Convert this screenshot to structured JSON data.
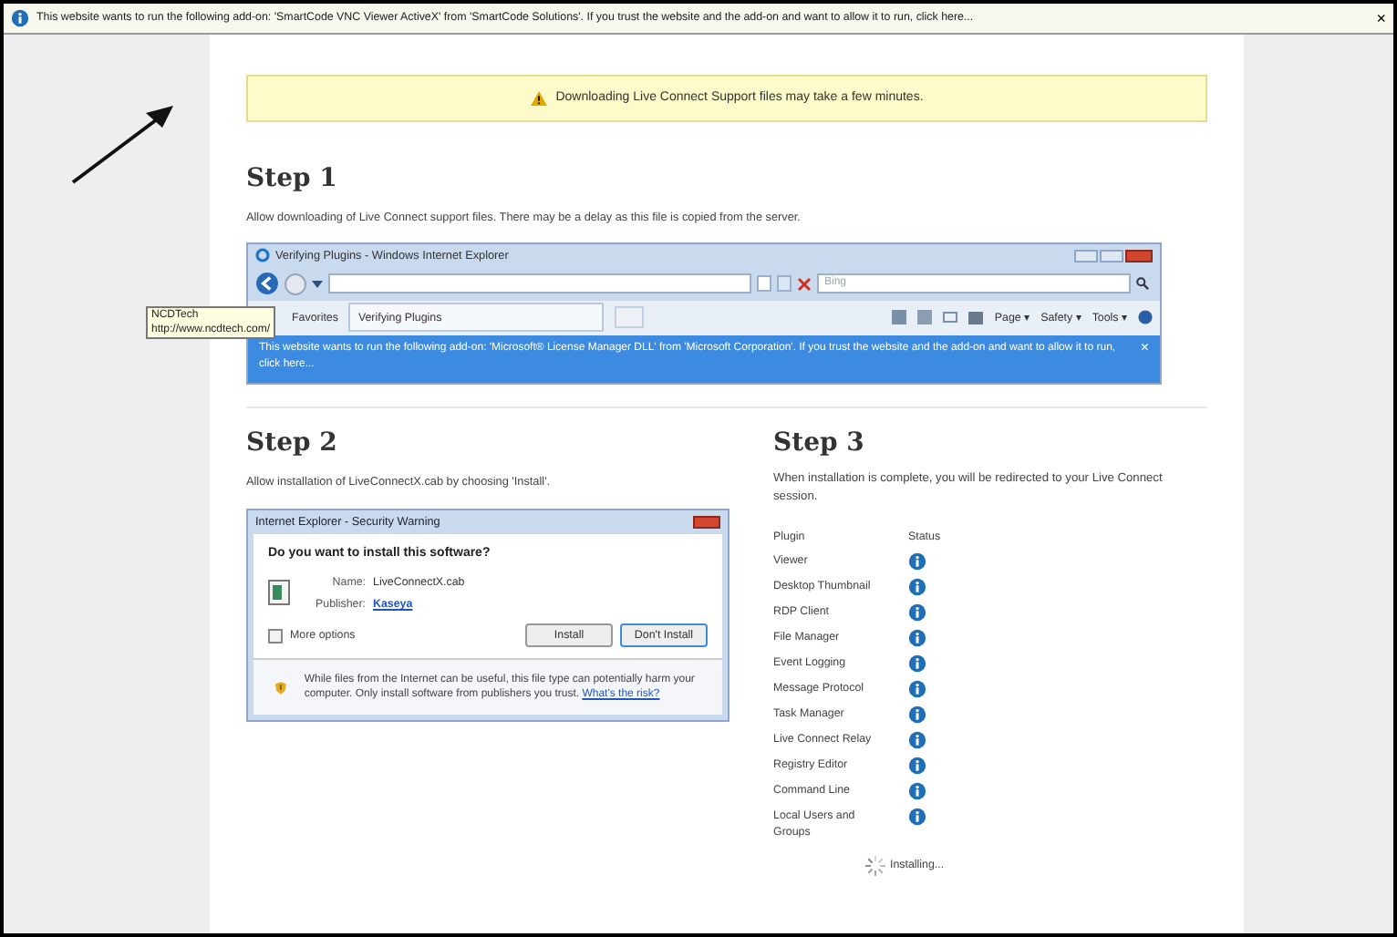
{
  "info_bar": {
    "text": "This website wants to run the following add-on: 'SmartCode VNC Viewer ActiveX' from 'SmartCode Solutions'. If you trust the website and the add-on and want to allow it to run, click here...",
    "close": "×"
  },
  "notice": {
    "text": "Downloading Live Connect Support files may take a few minutes."
  },
  "step1": {
    "title": "Step 1",
    "description": "Allow downloading of Live Connect support files. There may be a delay as this file is copied from the server.",
    "ie_window": {
      "title": "Verifying Plugins - Windows Internet Explorer",
      "search_placeholder": "Bing",
      "favorites": "Favorites",
      "tab": "Verifying Plugins",
      "menus": [
        {
          "label": "Page ▾"
        },
        {
          "label": "Safety ▾"
        },
        {
          "label": "Tools ▾"
        }
      ],
      "info_bar": {
        "text": "This website wants to run the following add-on: 'Microsoft® License Manager DLL' from 'Microsoft Corporation'. If you trust the website and the add-on and want to allow it to run, click here...",
        "close": "×"
      }
    }
  },
  "tooltip": {
    "lines": [
      "NCDTech",
      "http://www.ncdtech.com/"
    ]
  },
  "step2": {
    "title": "Step 2",
    "description": "Allow installation of LiveConnectX.cab by choosing 'Install'.",
    "dialog": {
      "title": "Internet Explorer - Security Warning",
      "question": "Do you want to install this software?",
      "name_label": "Name:",
      "name_value": "LiveConnectX.cab",
      "publisher_label": "Publisher:",
      "publisher_value": "Kaseya",
      "more_options": "More options",
      "buttons": [
        {
          "label": "Install",
          "selected": false
        },
        {
          "label": "Don't Install",
          "selected": true
        }
      ],
      "warning": "While files from the Internet can be useful, this file type can potentially harm your computer. Only install software from publishers you trust.",
      "risk_link": "What's the risk?"
    }
  },
  "step3": {
    "title": "Step 3",
    "description": "When installation is complete, you will be redirected to your Live Connect session.",
    "columns": [
      "Plugin",
      "Status"
    ],
    "plugins": [
      {
        "name": "Viewer"
      },
      {
        "name": "Desktop Thumbnail"
      },
      {
        "name": "RDP Client"
      },
      {
        "name": "File Manager"
      },
      {
        "name": "Event Logging"
      },
      {
        "name": "Message Protocol"
      },
      {
        "name": "Task Manager"
      },
      {
        "name": "Live Connect Relay"
      },
      {
        "name": "Registry Editor"
      },
      {
        "name": "Command Line"
      },
      {
        "name": "Local Users and Groups"
      }
    ],
    "installing": "Installing..."
  }
}
